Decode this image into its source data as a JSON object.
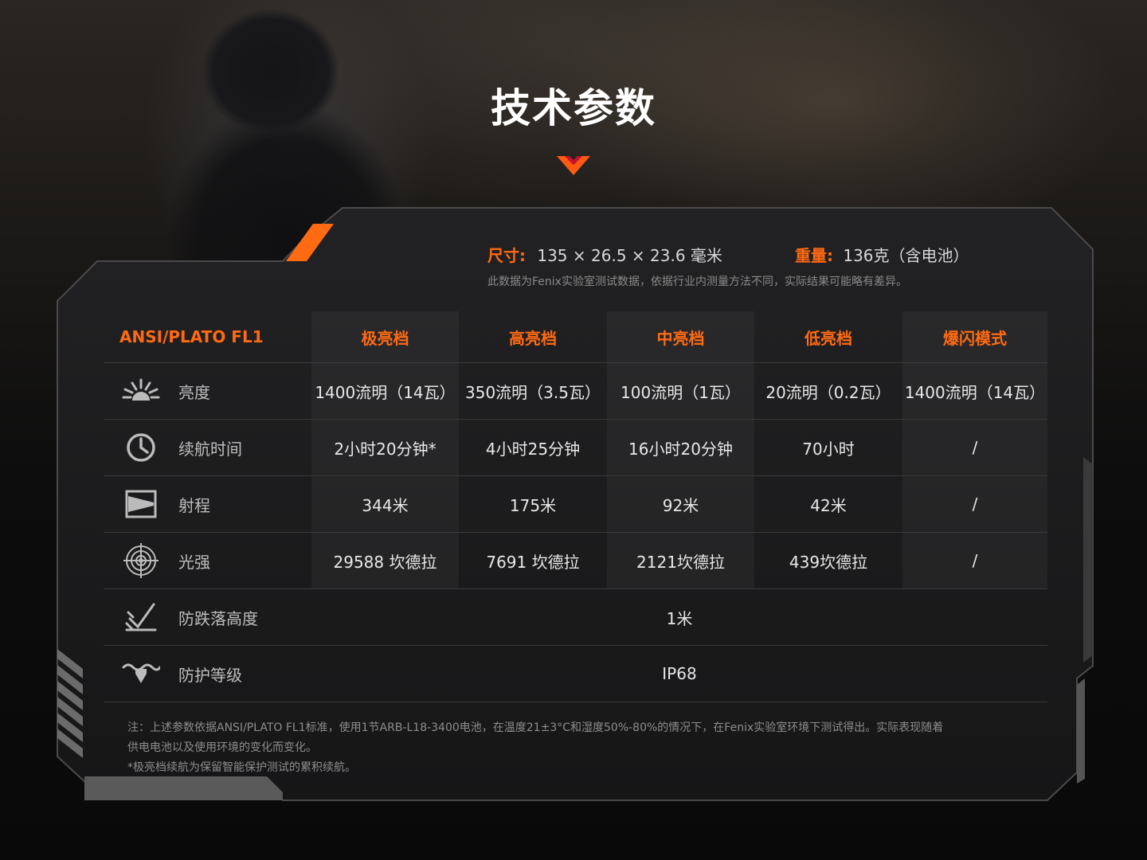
{
  "page": {
    "title": "技术参数"
  },
  "specs": {
    "size_label": "尺寸:",
    "size_value": "135 × 26.5 × 23.6 毫米",
    "weight_label": "重量:",
    "weight_value": "136克（含电池）",
    "disclaimer": "此数据为Fenix实验室测试数据，依据行业内测量方法不同，实际结果可能略有差异。"
  },
  "table": {
    "standard": "ANSI/PLATO FL1",
    "modes": [
      "极亮档",
      "高亮档",
      "中亮档",
      "低亮档",
      "爆闪模式"
    ],
    "rows": [
      {
        "icon": "brightness-icon",
        "label": "亮度",
        "values": [
          "1400流明（14瓦）",
          "350流明（3.5瓦）",
          "100流明（1瓦）",
          "20流明（0.2瓦）",
          "1400流明（14瓦）"
        ]
      },
      {
        "icon": "clock-icon",
        "label": "续航时间",
        "values": [
          "2小时20分钟*",
          "4小时25分钟",
          "16小时20分钟",
          "70小时",
          "/"
        ]
      },
      {
        "icon": "range-icon",
        "label": "射程",
        "values": [
          "344米",
          "175米",
          "92米",
          "42米",
          "/"
        ]
      },
      {
        "icon": "target-icon",
        "label": "光强",
        "values": [
          "29588 坎德拉",
          "7691 坎德拉",
          "2121坎德拉",
          "439坎德拉",
          "/"
        ]
      }
    ],
    "span_rows": [
      {
        "icon": "impact-resistance-icon",
        "label": "防跌落高度",
        "value": "1米"
      },
      {
        "icon": "waterproof-icon",
        "label": "防护等级",
        "value": "IP68"
      }
    ]
  },
  "footnote": {
    "line1": "注：上述参数依据ANSI/PLATO FL1标准，使用1节ARB-L18-3400电池，在温度21±3°C和湿度50%-80%的情况下，在Fenix实验室环境下测试得出。实际表现随着",
    "line2": "供电电池以及使用环境的变化而变化。",
    "line3": "*极亮档续航为保留智能保护测试的累积续航。"
  },
  "colors": {
    "accent": "#ff6a13",
    "panel": "#1a1a1b",
    "frame": "#3c3c3c"
  }
}
